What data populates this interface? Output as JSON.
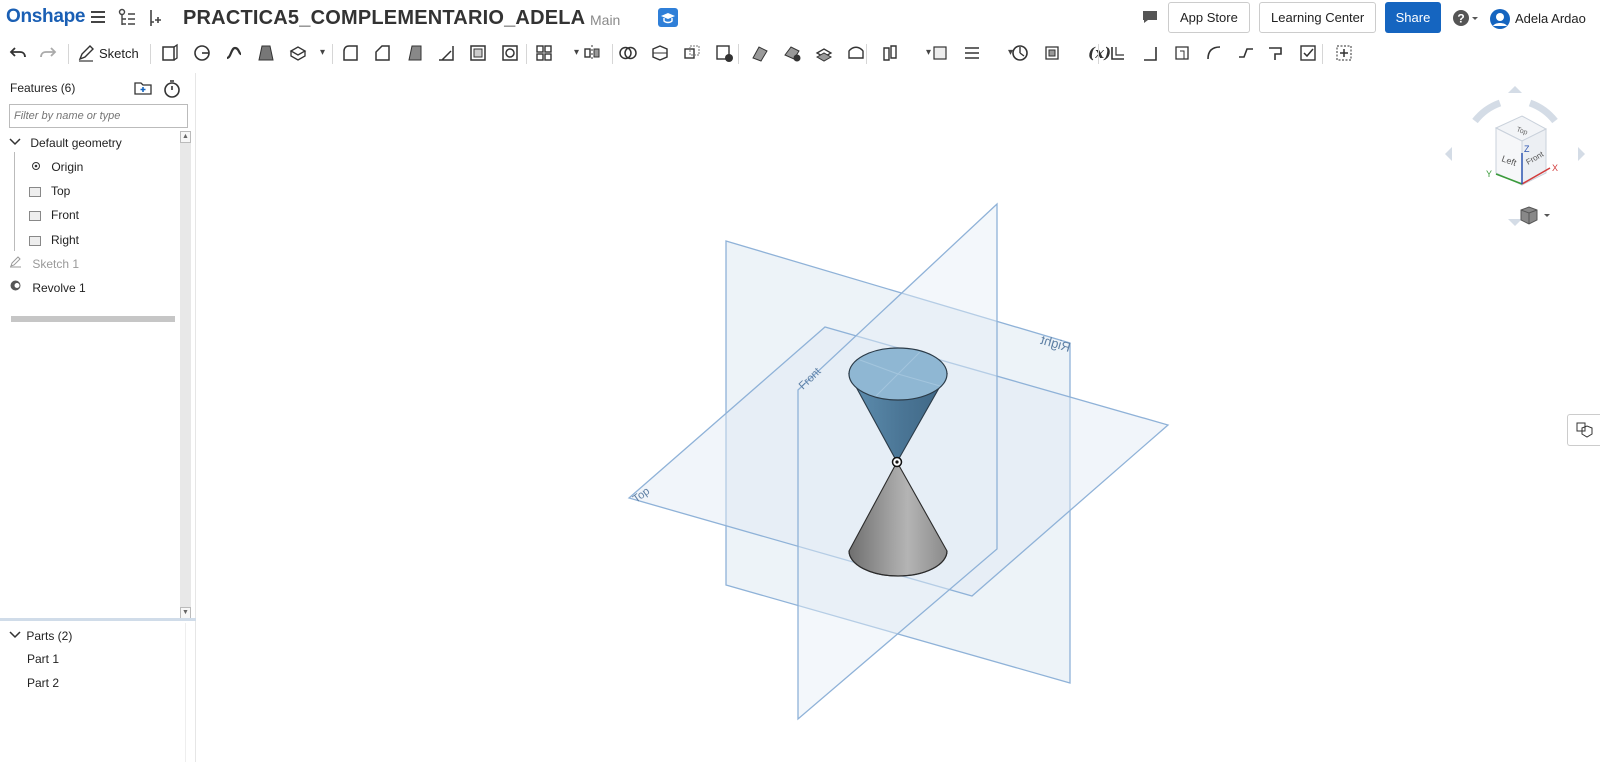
{
  "topbar": {
    "logo": "Onshape",
    "menu_icon": "hamburger-icon",
    "doc_title": "PRACTICA5_COMPLEMENTARIO_ADELA",
    "branch": "Main",
    "app_store": "App Store",
    "learning_center": "Learning Center",
    "share": "Share",
    "help": "?",
    "user": "Adela Ardao"
  },
  "toolbar": {
    "sketch_label": "Sketch",
    "variable_label": "(x)"
  },
  "features": {
    "header": "Features (6)",
    "filter_placeholder": "Filter by name or type",
    "default_geometry": "Default geometry",
    "origin": "Origin",
    "planes": [
      "Top",
      "Front",
      "Right"
    ],
    "sketch": "Sketch 1",
    "revolve": "Revolve 1"
  },
  "parts": {
    "header": "Parts (2)",
    "items": [
      "Part 1",
      "Part 2"
    ]
  },
  "viewport": {
    "plane_labels": {
      "top": "Top",
      "front": "Front",
      "right": "Right"
    },
    "cube": {
      "top": "Top",
      "left": "Left",
      "front": "Front",
      "x": "X",
      "y": "Y",
      "z": "Z"
    }
  },
  "colors": {
    "brand": "#1a5fb4",
    "share": "#1565c0",
    "plane_stroke": "#8fb2d8",
    "plane_fill": "#dce8f4"
  }
}
